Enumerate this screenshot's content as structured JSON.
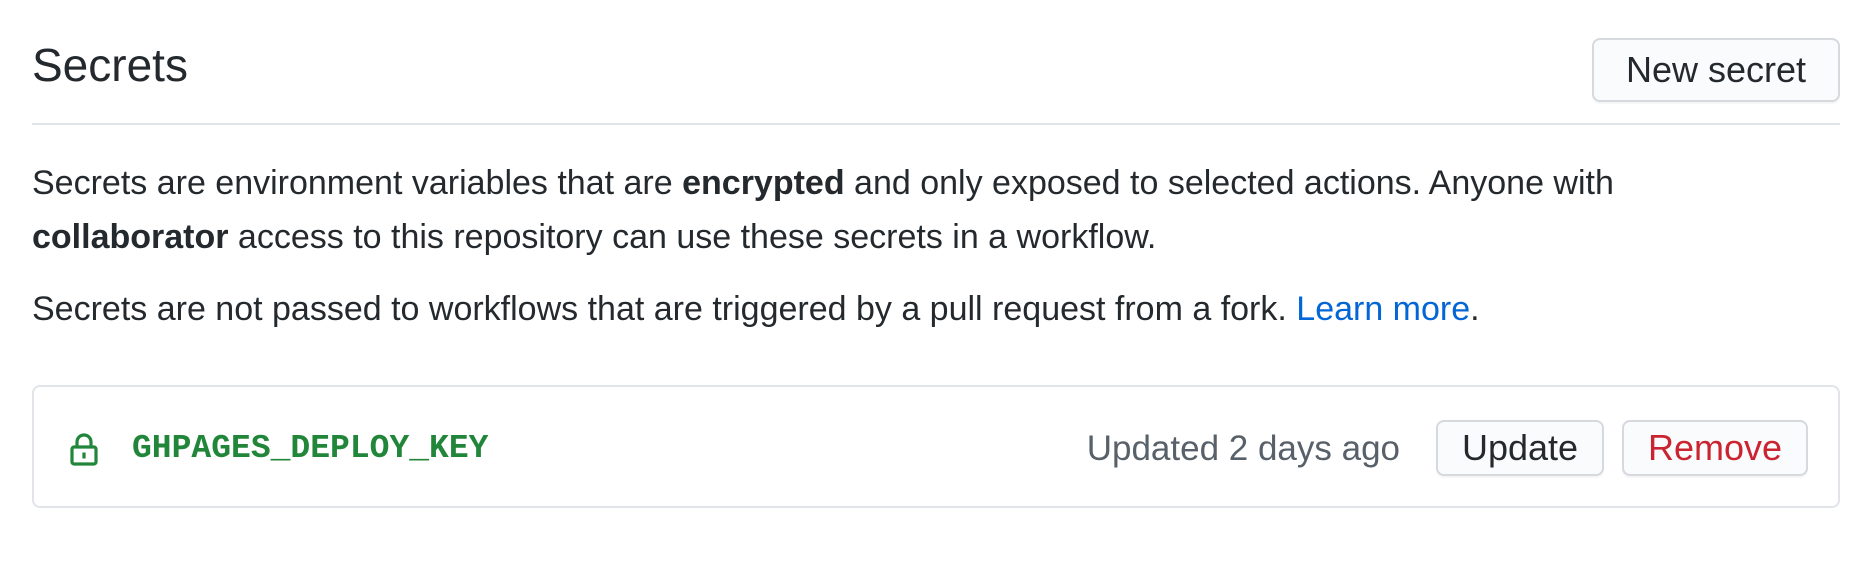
{
  "header": {
    "title": "Secrets",
    "new_secret_label": "New secret"
  },
  "description": {
    "part1": "Secrets are environment variables that are ",
    "bold1": "encrypted",
    "part2": " and only exposed to selected actions. Anyone with ",
    "bold2": "collaborator",
    "part3": " access to this repository can use these secrets in a workflow."
  },
  "fork_notice": {
    "text": "Secrets are not passed to workflows that are triggered by a pull request from a fork. ",
    "link_label": "Learn more",
    "trailing": "."
  },
  "secrets": [
    {
      "icon": "lock-icon",
      "name": "GHPAGES_DEPLOY_KEY",
      "updated": "Updated 2 days ago",
      "update_label": "Update",
      "remove_label": "Remove"
    }
  ],
  "colors": {
    "secret_name": "#22863a",
    "link": "#0366d6",
    "remove": "#cb2431",
    "muted": "#586069"
  }
}
